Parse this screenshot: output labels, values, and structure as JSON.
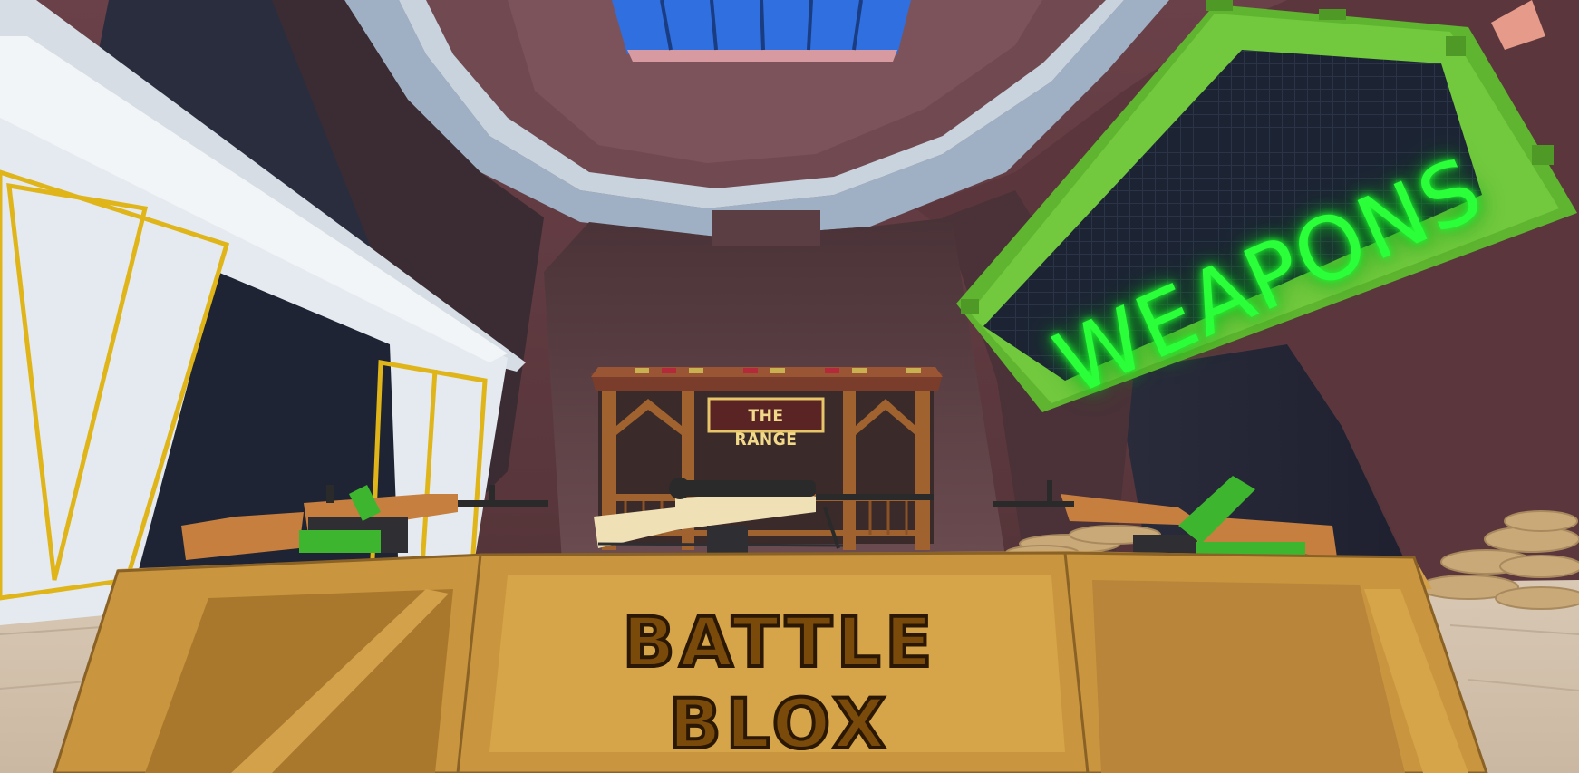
{
  "scene": {
    "title": "Weapons shop lobby",
    "signs": {
      "neon": "WEAPONS",
      "booth": "THE RANGE",
      "counter": "BATTLE BLOX"
    },
    "colors": {
      "neon_green": "#2bff3a",
      "sign_frame": "#6cc33a",
      "counter_wood": "#c9963f",
      "wall": "#5e3a3f",
      "skylight": "#2f6fe0"
    },
    "weapons": [
      "left-rifle",
      "sniper-rifle",
      "right-rifle"
    ]
  }
}
